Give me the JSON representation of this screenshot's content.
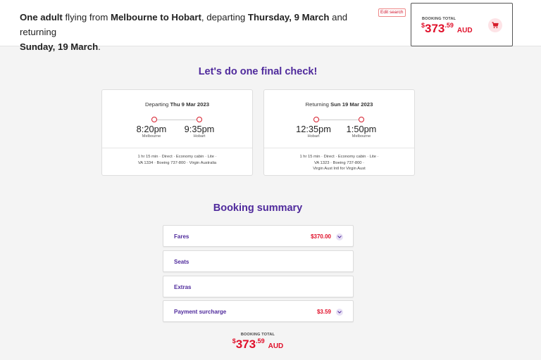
{
  "header": {
    "summary": {
      "part1": "One adult",
      "part2": " flying from ",
      "part3": "Melbourne to Hobart",
      "part4": ", departing ",
      "part5": "Thursday, 9 March",
      "part6": " and returning ",
      "part7": "Sunday, 19 March",
      "part8": "."
    },
    "edit_search": "Edit search",
    "booking_total_label": "BOOKING TOTAL",
    "total": {
      "dollar": "$",
      "whole": "373",
      "cents": ".59",
      "currency": "AUD"
    },
    "cart_icon": "shopping-cart-icon"
  },
  "final_check_title": "Let's do one final check!",
  "flights": [
    {
      "heading_prefix": "Departing ",
      "heading_date": "Thu 9 Mar 2023",
      "depart_time": "8:20pm",
      "depart_city": "Melbourne",
      "arrive_time": "9:35pm",
      "arrive_city": "Hobart",
      "details_line1": "1 hr 15 min · Direct · Economy cabin · Lite ·",
      "details_line2": "VA 1334 · Boeing 737-800 · Virgin Australia",
      "details_line3": ""
    },
    {
      "heading_prefix": "Returning ",
      "heading_date": "Sun 19 Mar 2023",
      "depart_time": "12:35pm",
      "depart_city": "Hobart",
      "arrive_time": "1:50pm",
      "arrive_city": "Melbourne",
      "details_line1": "1 hr 15 min · Direct · Economy cabin · Lite ·",
      "details_line2": "VA 1323 · Boeing 737-800 ·",
      "details_line3": "Virgin Aust Intl for Virgin Aust"
    }
  ],
  "booking_summary": {
    "title": "Booking summary",
    "rows": [
      {
        "label": "Fares",
        "amount": "$370.00",
        "expandable": true
      },
      {
        "label": "Seats",
        "amount": "",
        "expandable": false
      },
      {
        "label": "Extras",
        "amount": "",
        "expandable": false
      },
      {
        "label": "Payment surcharge",
        "amount": "$3.59",
        "expandable": true
      }
    ],
    "total_label": "BOOKING TOTAL",
    "total": {
      "dollar": "$",
      "whole": "373",
      "cents": ".59",
      "currency": "AUD"
    }
  },
  "colors": {
    "brand_purple": "#4f2a9c",
    "accent_red": "#e0102a"
  }
}
